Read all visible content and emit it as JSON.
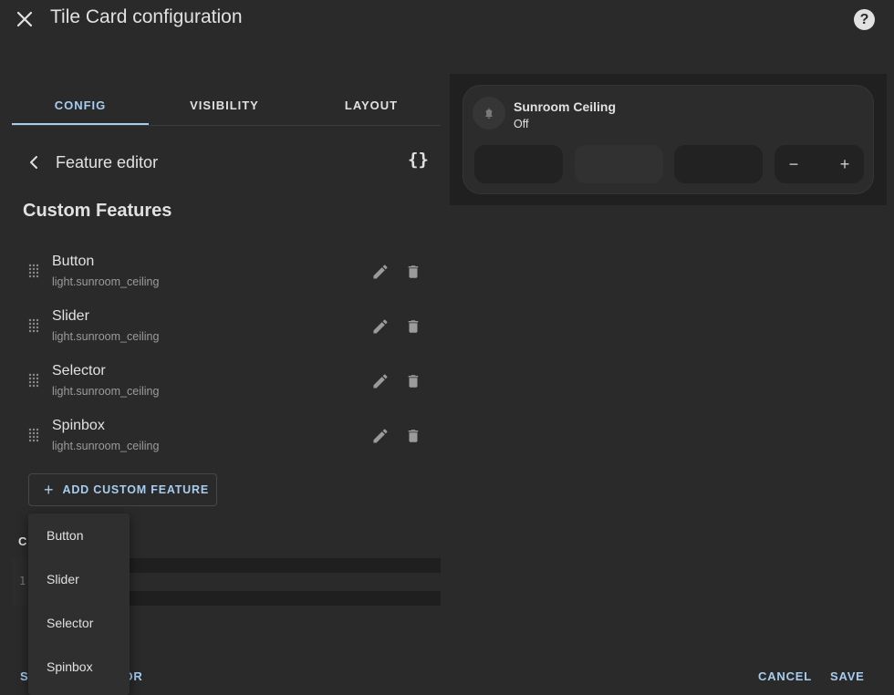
{
  "dialog": {
    "title": "Tile Card configuration",
    "close_icon": "close-icon",
    "help_icon": "help-icon",
    "help_glyph": "?"
  },
  "tabs": [
    {
      "label": "CONFIG",
      "active": true
    },
    {
      "label": "VISIBILITY",
      "active": false
    },
    {
      "label": "LAYOUT",
      "active": false
    }
  ],
  "editor": {
    "title": "Feature editor",
    "code_toggle": "{}"
  },
  "section": {
    "title": "Custom Features"
  },
  "features": [
    {
      "name": "Button",
      "entity": "light.sunroom_ceiling"
    },
    {
      "name": "Slider",
      "entity": "light.sunroom_ceiling"
    },
    {
      "name": "Selector",
      "entity": "light.sunroom_ceiling"
    },
    {
      "name": "Spinbox",
      "entity": "light.sunroom_ceiling"
    }
  ],
  "add_button": {
    "label": "ADD CUSTOM FEATURE",
    "icon": "+"
  },
  "yaml": {
    "label": "C",
    "line_number": "1"
  },
  "dropdown": {
    "items": [
      "Button",
      "Slider",
      "Selector",
      "Spinbox"
    ]
  },
  "footer": {
    "left_label_start": "S",
    "left_label_end": "OR",
    "cancel": "CANCEL",
    "save": "SAVE"
  },
  "preview": {
    "name": "Sunroom Ceiling",
    "state": "Off",
    "spinbox_minus": "−",
    "spinbox_plus": "+"
  },
  "colors": {
    "accent": "#a6cdf0",
    "background": "#2a2a2b",
    "text": "#e1e1e1",
    "secondary_text": "#9b9b9b"
  }
}
